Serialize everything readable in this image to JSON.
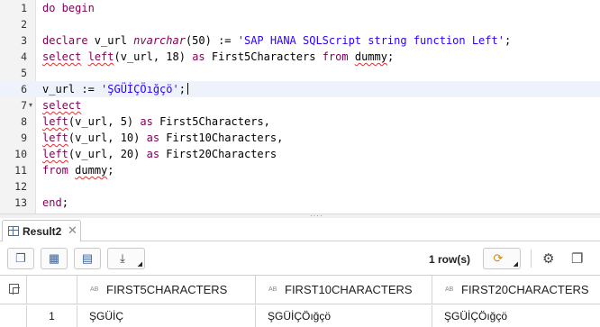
{
  "editor": {
    "lines": [
      {
        "n": "1",
        "html": "<span class=\"kw\">do begin</span>"
      },
      {
        "n": "2",
        "html": ""
      },
      {
        "n": "3",
        "html": "<span class=\"kw\">declare</span> v_url <span class=\"it\">nvarchar</span>(50) := <span class=\"str\">'SAP HANA SQLScript string function Left'</span>;"
      },
      {
        "n": "4",
        "html": "<span class=\"kw sq\">select</span> <span class=\"kw sq\">left</span>(v_url, 18) <span class=\"kw\">as</span> First5Characters <span class=\"kw\">from</span> <span class=\"sq\">dummy</span>;"
      },
      {
        "n": "5",
        "html": ""
      },
      {
        "n": "6",
        "html": "v_url := <span class=\"str\">'ŞGÜİÇÖığçö'</span>;<span class=\"cursor\"></span>",
        "active": true
      },
      {
        "n": "7",
        "html": "<span class=\"kw sq\">select</span>",
        "fold": true
      },
      {
        "n": "8",
        "html": "<span class=\"kw sq\">left</span>(v_url, 5) <span class=\"kw\">as</span> First5Characters,"
      },
      {
        "n": "9",
        "html": "<span class=\"kw sq\">left</span>(v_url, 10) <span class=\"kw\">as</span> First10Characters,"
      },
      {
        "n": "10",
        "html": "<span class=\"kw sq\">left</span>(v_url, 20) <span class=\"kw\">as</span> First20Characters"
      },
      {
        "n": "11",
        "html": "<span class=\"kw\">from</span> <span class=\"sq\">dummy</span>;"
      },
      {
        "n": "12",
        "html": ""
      },
      {
        "n": "13",
        "html": "<span class=\"kw\">end</span>;"
      }
    ]
  },
  "result_tab": {
    "label": "Result2",
    "close": "✕"
  },
  "toolbar": {
    "row_count": "1 row(s)",
    "icons": [
      "copy-icon",
      "table-view-icon",
      "chart-view-icon",
      "export-download-icon",
      "refresh-icon",
      "settings-icon",
      "maximize-icon"
    ],
    "accent_color": "#3d5f95"
  },
  "grid": {
    "type_badge": "AB",
    "columns": [
      "FIRST5CHARACTERS",
      "FIRST10CHARACTERS",
      "FIRST20CHARACTERS"
    ],
    "rows": [
      {
        "num": "1",
        "cells": [
          "ŞGÜİÇ",
          "ŞGÜİÇÖığçö",
          "ŞGÜİÇÖığçö"
        ]
      }
    ]
  }
}
